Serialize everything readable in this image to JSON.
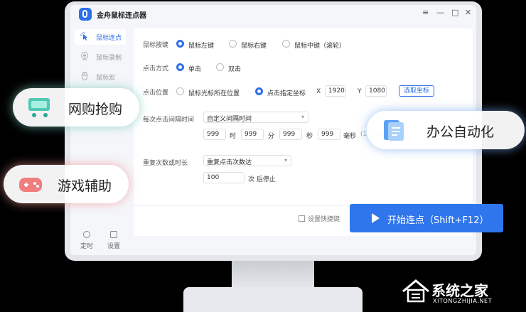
{
  "app": {
    "title": "金舟鼠标连点器"
  },
  "window_controls": {
    "menu": "≡",
    "minimize": "—",
    "maximize": "□",
    "close": "✕"
  },
  "sidebar": {
    "items": [
      {
        "label": "鼠标连点",
        "icon": "cursor-click-icon",
        "active": true
      },
      {
        "label": "鼠标录制",
        "icon": "record-icon",
        "active": false
      },
      {
        "label": "鼠标宏",
        "icon": "mouse-icon",
        "active": false
      }
    ],
    "bottom": [
      {
        "label": "定时",
        "icon": "timer-icon"
      },
      {
        "label": "设置",
        "icon": "settings-icon"
      }
    ]
  },
  "form": {
    "mouse_button": {
      "label": "鼠标按键",
      "options": [
        "鼠标左键",
        "鼠标右键",
        "鼠标中键（滚轮）"
      ],
      "selected": 0
    },
    "click_mode": {
      "label": "点击方式",
      "options": [
        "单击",
        "双击"
      ],
      "selected": 0
    },
    "click_position": {
      "label": "点击位置",
      "options": [
        "鼠标光标所在位置",
        "点击指定坐标"
      ],
      "selected": 1,
      "x_label": "X",
      "x_value": "1920",
      "y_label": "Y",
      "y_value": "1080",
      "pick_button": "选取坐标"
    },
    "interval": {
      "label": "每次点击间隔时间",
      "mode": "自定义间隔时间",
      "hours": "999",
      "hours_unit": "时",
      "minutes": "999",
      "minutes_unit": "分",
      "seconds": "999",
      "seconds_unit": "秒",
      "ms": "999",
      "ms_unit": "毫秒",
      "range_hint": "(1~1000)"
    },
    "repeat": {
      "label": "重复次数或时长",
      "mode": "重复点击次数达",
      "count": "100",
      "suffix": "次 后停止"
    }
  },
  "footer": {
    "shortcut_label": "设置快捷键",
    "start_label": "开始连点（Shift+F12）"
  },
  "badges": [
    {
      "label": "网购抢购",
      "icon": "shopping-cart-icon"
    },
    {
      "label": "游戏辅助",
      "icon": "gamepad-icon"
    },
    {
      "label": "办公自动化",
      "icon": "document-icon"
    }
  ],
  "watermark": {
    "text": "系统之家",
    "sub": "XITONGZHIJIA.NET"
  },
  "colors": {
    "accent": "#2e6fe8",
    "button": "#2f76ec"
  }
}
